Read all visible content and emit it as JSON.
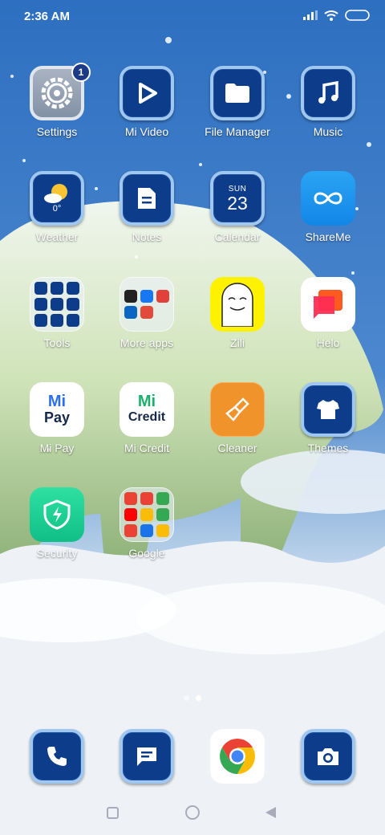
{
  "status": {
    "time": "2:36 AM"
  },
  "apps": [
    {
      "id": "settings",
      "label": "Settings",
      "badge": "1"
    },
    {
      "id": "mi-video",
      "label": "Mi Video"
    },
    {
      "id": "file-manager",
      "label": "File Manager"
    },
    {
      "id": "music",
      "label": "Music"
    },
    {
      "id": "weather",
      "label": "Weather",
      "temp": "0°"
    },
    {
      "id": "notes",
      "label": "Notes"
    },
    {
      "id": "calendar",
      "label": "Calendar",
      "day": "SUN",
      "date": "23"
    },
    {
      "id": "shareme",
      "label": "ShareMe"
    },
    {
      "id": "tools",
      "label": "Tools"
    },
    {
      "id": "more-apps",
      "label": "More apps"
    },
    {
      "id": "zili",
      "label": "Zili"
    },
    {
      "id": "helo",
      "label": "Helo"
    },
    {
      "id": "mi-pay",
      "label": "Mi Pay",
      "logo_top": "Mi",
      "logo_bottom": "Pay"
    },
    {
      "id": "mi-credit",
      "label": "Mi Credit",
      "logo_top": "Mi",
      "logo_bottom": "Credit"
    },
    {
      "id": "cleaner",
      "label": "Cleaner"
    },
    {
      "id": "themes",
      "label": "Themes"
    },
    {
      "id": "security",
      "label": "Security"
    },
    {
      "id": "google",
      "label": "Google"
    }
  ],
  "dock": [
    {
      "id": "phone",
      "icon": "phone-icon"
    },
    {
      "id": "messaging",
      "icon": "message-icon"
    },
    {
      "id": "chrome",
      "icon": "chrome-icon"
    },
    {
      "id": "camera",
      "icon": "camera-icon"
    }
  ],
  "page_indicator": {
    "pages": 2,
    "current": 2
  },
  "colors": {
    "icon_blue": "#0d3d8a",
    "icon_border": "#9fc7f0",
    "sky": "#2a63b4",
    "snow": "#eef2f7"
  }
}
